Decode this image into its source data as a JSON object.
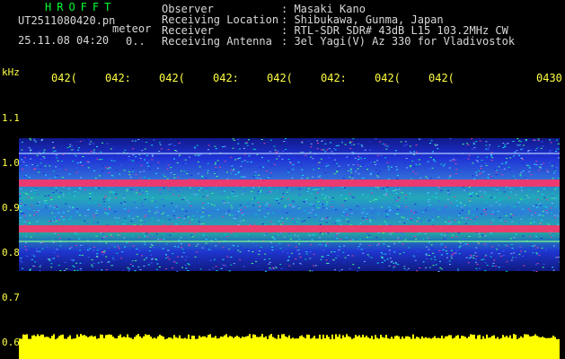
{
  "brand": "HROFFT",
  "file": {
    "name": "UT2511080420.pn",
    "type": "meteor",
    "timestamp": "25.11.08 04:20",
    "count": "0.."
  },
  "info": {
    "labels": [
      "Observer",
      "Receiving Location",
      "Receiver",
      "Receiving Antenna"
    ],
    "values": [
      ": Masaki Kano",
      ": Shibukawa, Gunma, Japan",
      ": RTL-SDR SDR# 43dB L15 103.2MHz CW",
      ": 3el Yagi(V) Az 330 for Vladivostok"
    ]
  },
  "axis": {
    "unit": "kHz",
    "time_ticks": [
      "042(",
      "042:",
      "042(",
      "042:",
      "042(",
      "042:",
      "042(",
      "042(",
      "0430"
    ],
    "freq_ticks": [
      "1.1",
      "1.0",
      "0.9",
      "0.8",
      "0.7",
      "0.6"
    ]
  },
  "colors": {
    "label": "#d8d8d8",
    "brand": "#00ff33",
    "axis": "#ffff44",
    "signal": "#ff3366",
    "noise": "#2a3cff",
    "floor": "#ffff00"
  }
}
